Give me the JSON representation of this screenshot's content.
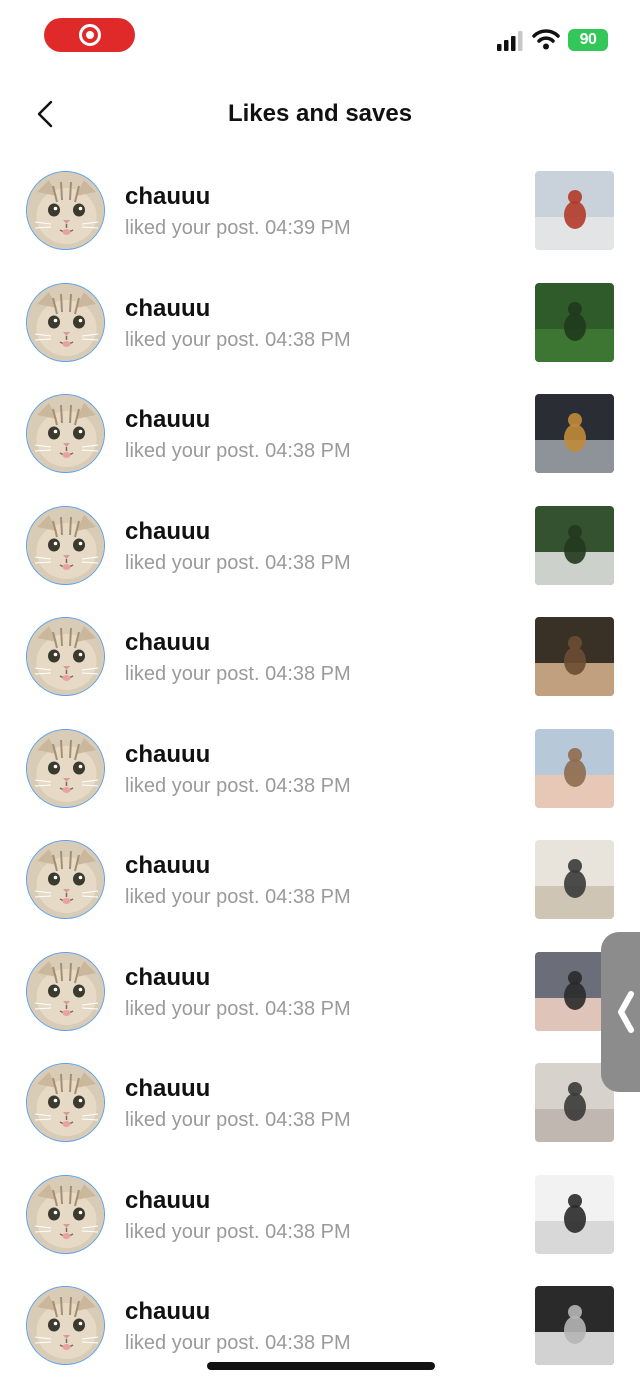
{
  "status_bar": {
    "battery_label": "90",
    "colors": {
      "recording": "#e02a2a",
      "battery": "#33c759"
    },
    "icons": [
      "record-icon",
      "cellular-signal-icon",
      "wifi-icon",
      "battery-icon"
    ]
  },
  "header": {
    "title": "Likes and saves",
    "back_icon": "chevron-left-icon"
  },
  "notifications": [
    {
      "username": "chauuu",
      "text": "liked your post. 04:39 PM",
      "thumb": "post-thumb-1"
    },
    {
      "username": "chauuu",
      "text": "liked your post. 04:38 PM",
      "thumb": "post-thumb-2"
    },
    {
      "username": "chauuu",
      "text": "liked your post. 04:38 PM",
      "thumb": "post-thumb-3"
    },
    {
      "username": "chauuu",
      "text": "liked your post. 04:38 PM",
      "thumb": "post-thumb-4"
    },
    {
      "username": "chauuu",
      "text": "liked your post. 04:38 PM",
      "thumb": "post-thumb-5"
    },
    {
      "username": "chauuu",
      "text": "liked your post. 04:38 PM",
      "thumb": "post-thumb-6"
    },
    {
      "username": "chauuu",
      "text": "liked your post. 04:38 PM",
      "thumb": "post-thumb-7"
    },
    {
      "username": "chauuu",
      "text": "liked your post. 04:38 PM",
      "thumb": "post-thumb-8"
    },
    {
      "username": "chauuu",
      "text": "liked your post. 04:38 PM",
      "thumb": "post-thumb-9"
    },
    {
      "username": "chauuu",
      "text": "liked your post. 04:38 PM",
      "thumb": "post-thumb-10"
    },
    {
      "username": "chauuu",
      "text": "liked your post. 04:38 PM",
      "thumb": "post-thumb-11"
    }
  ],
  "side_handle_icon": "chevron-left-icon"
}
